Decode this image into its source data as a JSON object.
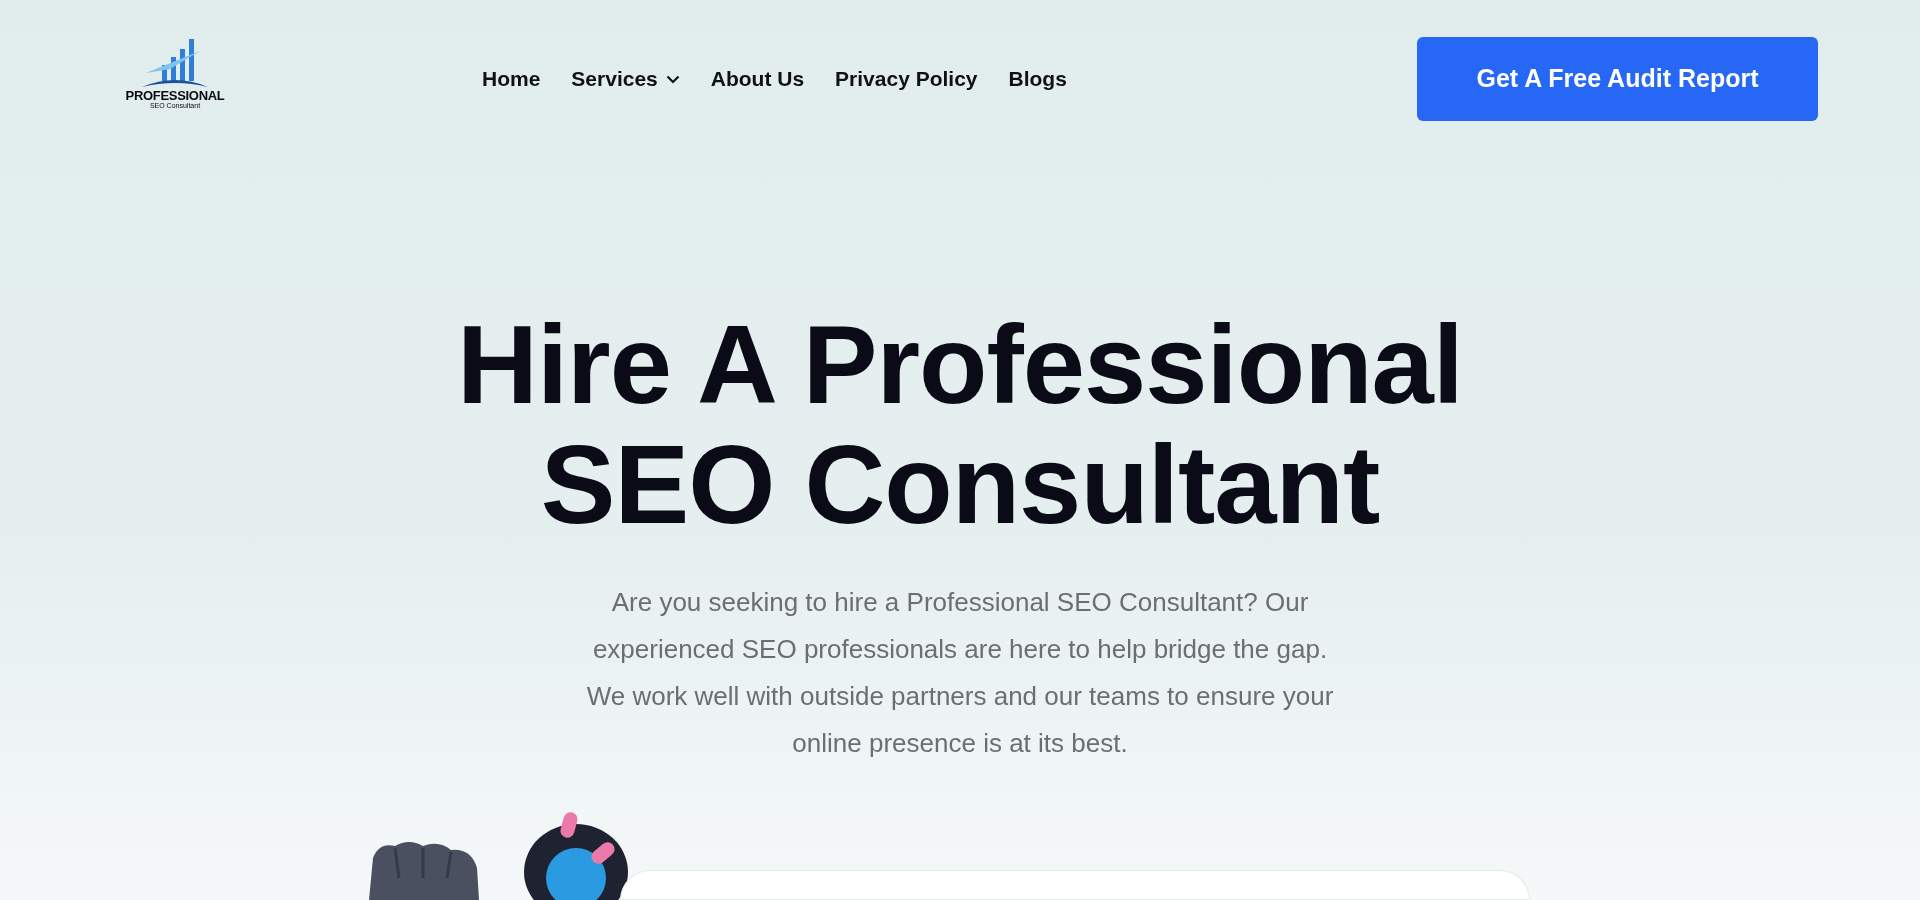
{
  "logo": {
    "title": "PROFESSIONAL",
    "subtitle": "SEO Consultant"
  },
  "nav": [
    {
      "label": "Home",
      "kind": "link"
    },
    {
      "label": "Services",
      "kind": "dropdown"
    },
    {
      "label": "About Us",
      "kind": "link"
    },
    {
      "label": "Privacy Policy",
      "kind": "link"
    },
    {
      "label": "Blogs",
      "kind": "link"
    }
  ],
  "cta": "Get A Free Audit Report",
  "hero": {
    "title_lines": [
      "Hire A Professional",
      "SEO Consultant"
    ],
    "description": "Are you seeking to hire a Professional SEO Consultant? Our experienced SEO professionals are here to help bridge the gap. We work well with outside partners and our teams to ensure your online presence is at its best."
  }
}
